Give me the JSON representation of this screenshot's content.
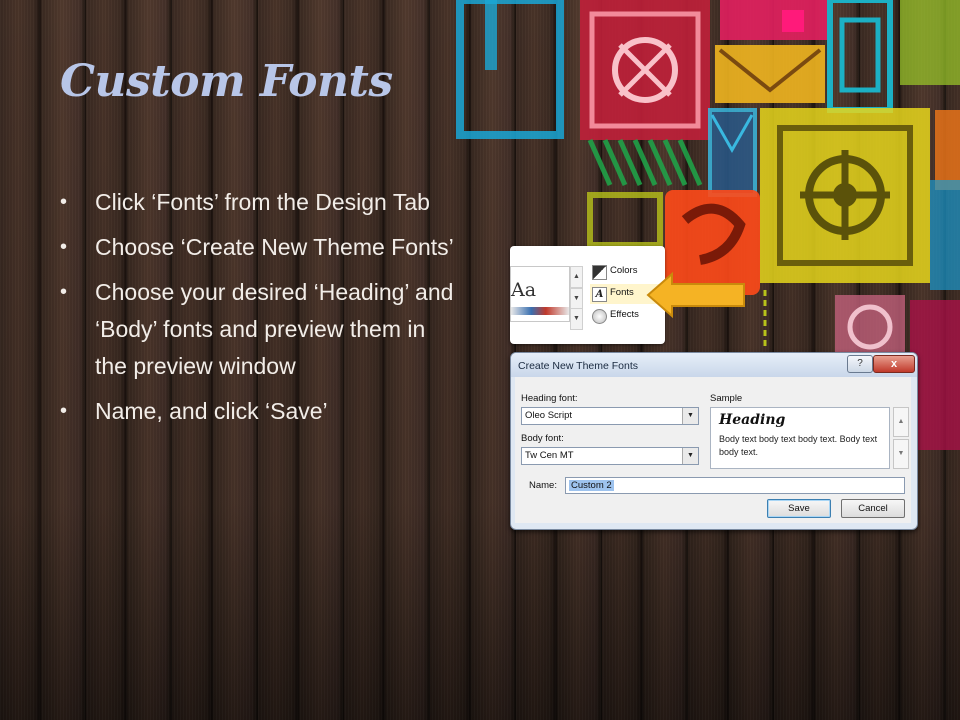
{
  "slide": {
    "title": "Custom Fonts",
    "bullets": [
      "Click ‘Fonts’ from the Design Tab",
      "Choose ‘Create New Theme Fonts’",
      "Choose your desired ‘Heading’ and ‘Body’ fonts and preview them in the preview window",
      "Name, and click ‘Save’"
    ],
    "title_color": "#b8c6e8",
    "text_color": "#f2ede8"
  },
  "ribbon": {
    "theme_preview_text": "Aa",
    "menu": [
      {
        "label": "Colors",
        "icon": "colors-icon"
      },
      {
        "label": "Fonts",
        "icon": "fonts-icon"
      },
      {
        "label": "Effects",
        "icon": "effects-icon"
      }
    ]
  },
  "arrow_color": "#f5b324",
  "dialog": {
    "title": "Create New Theme Fonts",
    "help_label": "?",
    "close_label": "x",
    "heading_font_label": "Heading font:",
    "heading_font_value": "Oleo Script",
    "body_font_label": "Body font:",
    "body_font_value": "Tw Cen MT",
    "sample_label": "Sample",
    "sample_heading": "Heading",
    "sample_body": "Body text body text body text. Body text body text.",
    "name_label": "Name:",
    "name_value": "Custom 2",
    "save_label": "Save",
    "cancel_label": "Cancel"
  }
}
